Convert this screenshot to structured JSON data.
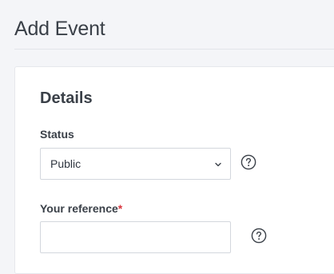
{
  "page": {
    "title": "Add Event"
  },
  "details": {
    "heading": "Details",
    "status": {
      "label": "Status",
      "value": "Public",
      "help_icon": "question-circle-icon",
      "dropdown_icon": "chevron-down-icon"
    },
    "reference": {
      "label": "Your reference",
      "required_mark": "*",
      "value": "",
      "placeholder": "",
      "help_icon": "question-circle-icon"
    }
  },
  "colors": {
    "background": "#f4f5f8",
    "required": "#d9363e",
    "border": "#d3d7dd",
    "text": "#3a4048"
  }
}
